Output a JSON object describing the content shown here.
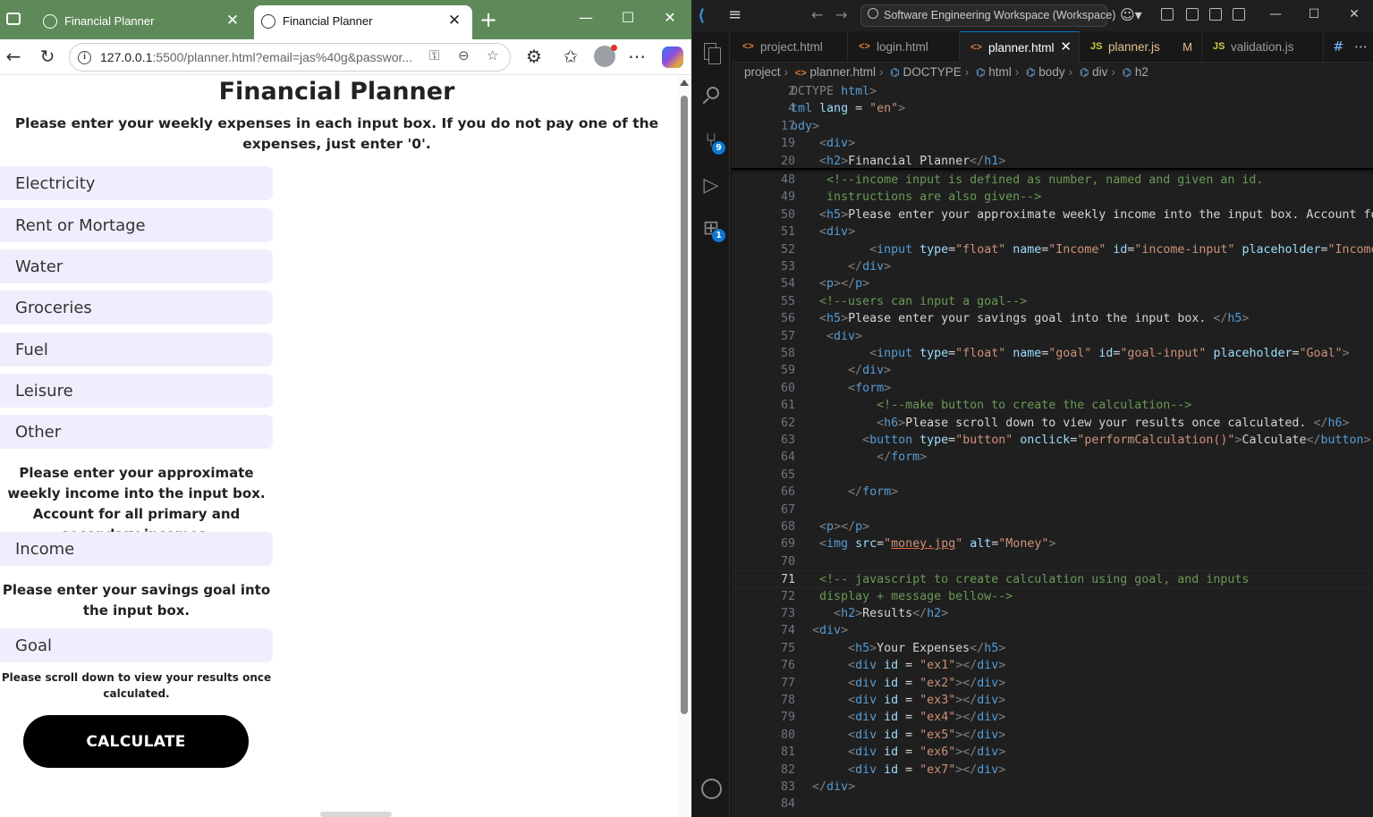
{
  "browser": {
    "tabs": [
      {
        "title": "Financial Planner",
        "active": false
      },
      {
        "title": "Financial Planner",
        "active": true
      }
    ],
    "url": {
      "host": "127.0.0.1",
      "rest": ":5500/planner.html?email=jas%40g&passwor..."
    }
  },
  "page": {
    "title": "Financial Planner",
    "instructions": "Please enter your weekly expenses in each input box. If you do not pay one of the expenses, just enter '0'.",
    "expense_fields": [
      "Electricity",
      "Rent or Mortage",
      "Water",
      "Groceries",
      "Fuel",
      "Leisure",
      "Other"
    ],
    "income_heading": "Please enter your approximate weekly income into the input box. Account for all primary and secondary incomes.",
    "income_placeholder": "Income",
    "goal_heading": "Please enter your savings goal into the input box.",
    "goal_placeholder": "Goal",
    "scroll_note": "Please scroll down to view your results once calculated.",
    "calculate_label": "CALCULATE"
  },
  "vscode": {
    "command_center": "Software Engineering Workspace (Workspace)",
    "source_control_badge": "9",
    "extensions_badge": "1",
    "editor_tabs": [
      {
        "icon": "<>",
        "label": "project.html",
        "active": false
      },
      {
        "icon": "<>",
        "label": "login.html",
        "active": false
      },
      {
        "icon": "<>",
        "label": "planner.html",
        "active": true
      },
      {
        "icon": "JS",
        "label": "planner.js",
        "status": "M",
        "active": false
      },
      {
        "icon": "JS",
        "label": "validation.js",
        "active": false
      }
    ],
    "breadcrumb": [
      "project",
      "planner.html",
      "DOCTYPE",
      "html",
      "body",
      "div",
      "h2"
    ],
    "active_line": "71"
  }
}
